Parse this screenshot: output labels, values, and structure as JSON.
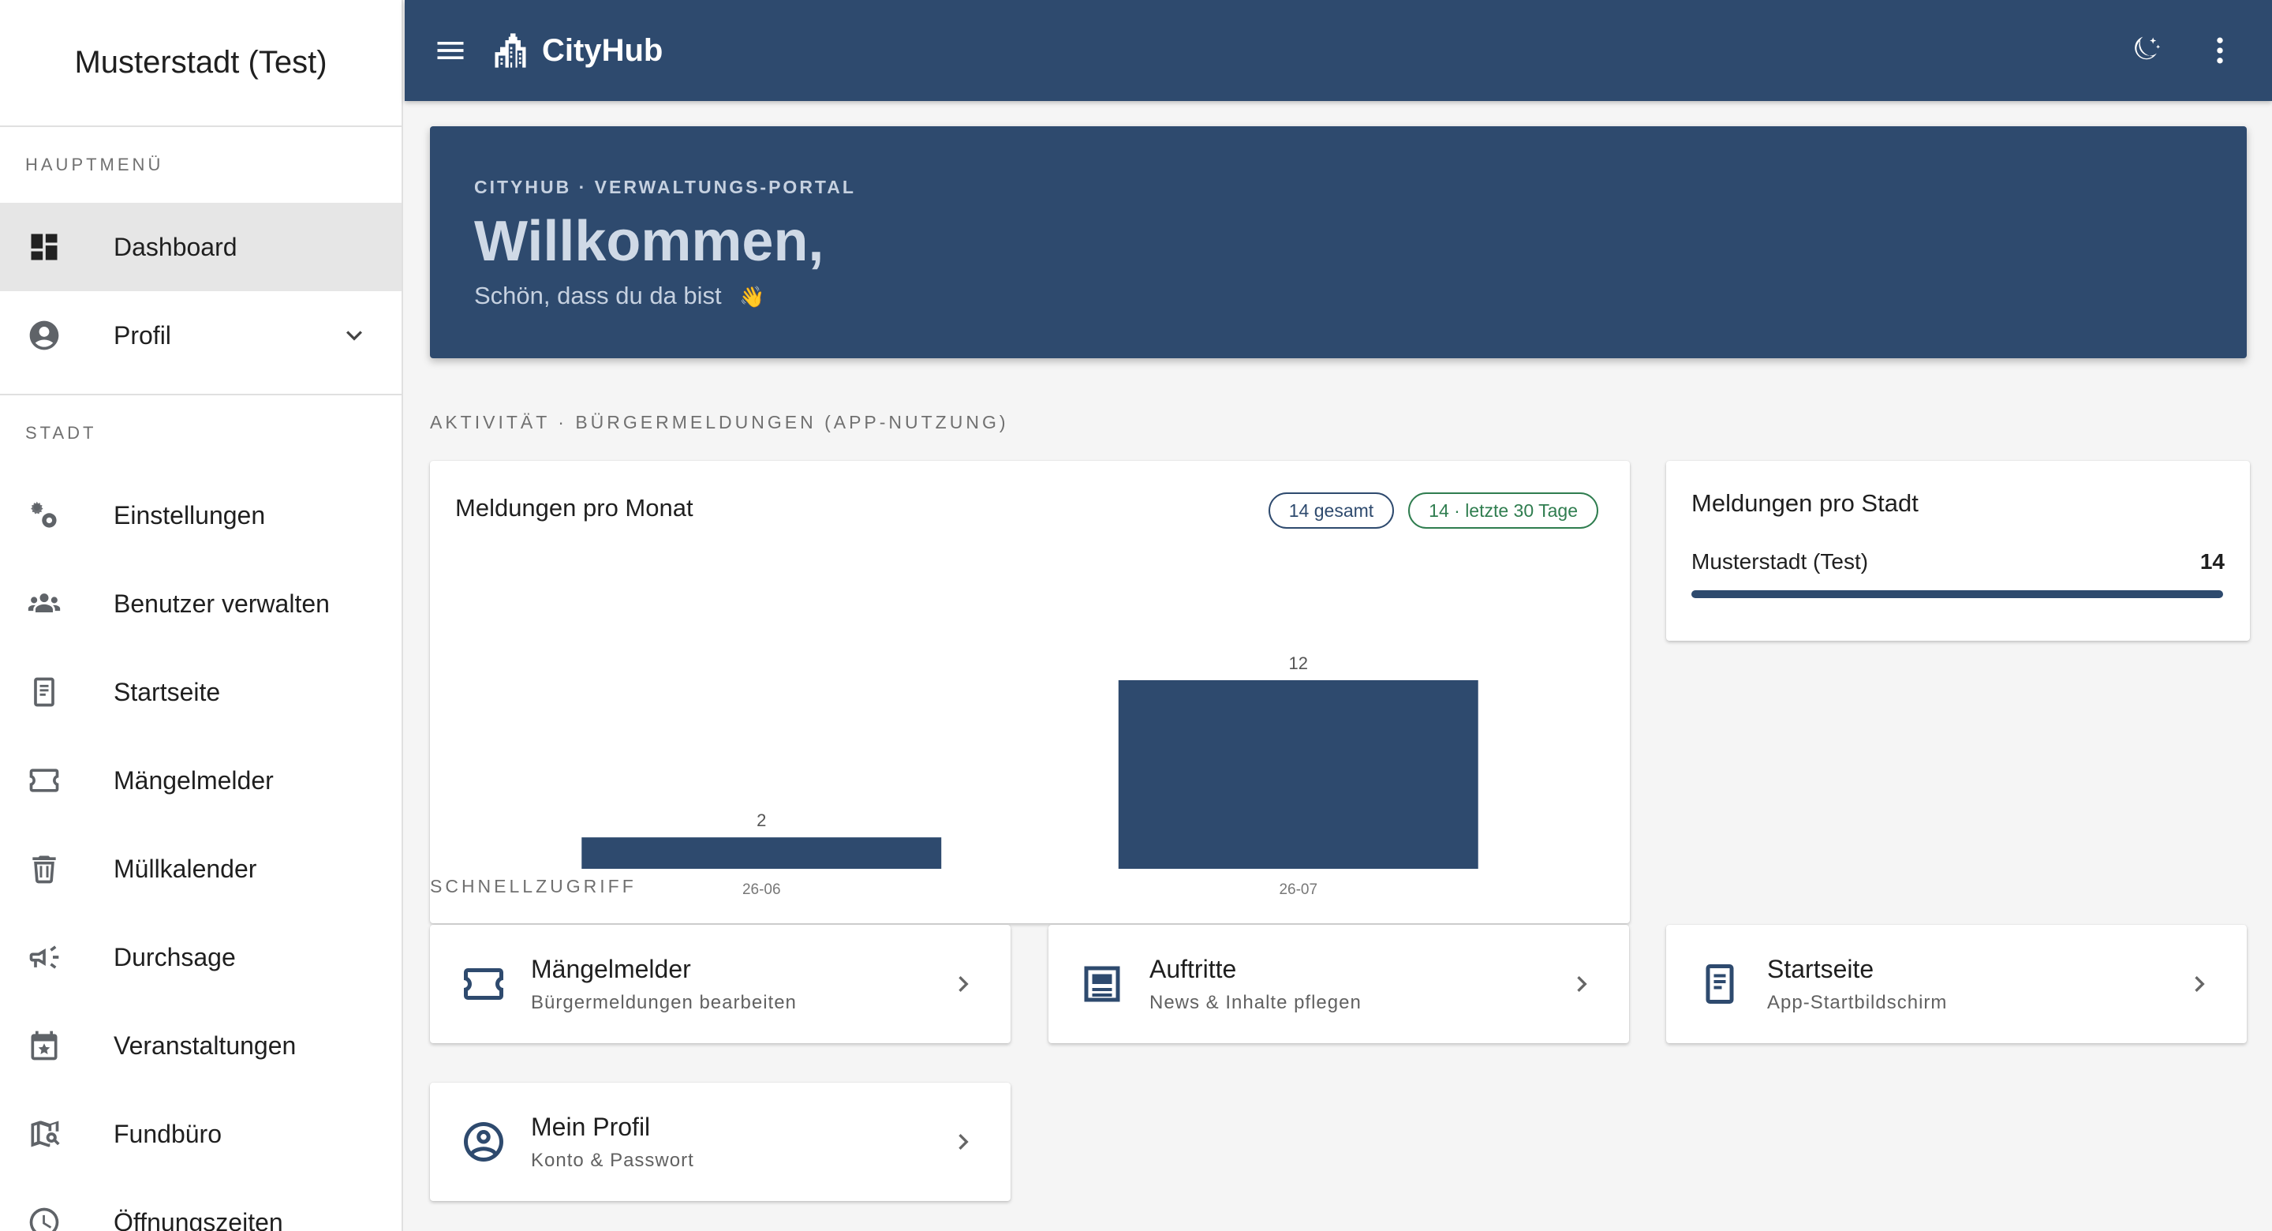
{
  "app": {
    "name": "CityHub"
  },
  "sidebar": {
    "title": "Musterstadt (Test)",
    "sections": [
      {
        "label": "HAUPTMENÜ"
      },
      {
        "label": "STADT"
      }
    ],
    "items": [
      {
        "label": "Dashboard",
        "icon": "dashboard-icon",
        "active": true
      },
      {
        "label": "Profil",
        "icon": "account-circle-icon"
      },
      {
        "label": "Einstellungen",
        "icon": "settings-icon"
      },
      {
        "label": "Benutzer verwalten",
        "icon": "people-icon"
      },
      {
        "label": "Startseite",
        "icon": "phone-page-icon"
      },
      {
        "label": "Mängelmelder",
        "icon": "ticket-icon"
      },
      {
        "label": "Müllkalender",
        "icon": "trash-icon"
      },
      {
        "label": "Durchsage",
        "icon": "megaphone-icon"
      },
      {
        "label": "Veranstaltungen",
        "icon": "calendar-star-icon"
      },
      {
        "label": "Fundbüro",
        "icon": "map-search-icon"
      },
      {
        "label": "Öffnungszeiten",
        "icon": "clock-icon"
      }
    ]
  },
  "hero": {
    "eyebrow": "CITYHUB · VERWALTUNGS-PORTAL",
    "title": "Willkommen,",
    "subtitle": "Schön, dass du da bist",
    "emoji": "👋"
  },
  "activity": {
    "label": "AKTIVITÄT · BÜRGERMELDUNGEN (APP-NUTZUNG)"
  },
  "monthly_card": {
    "title": "Meldungen pro Monat",
    "pill_total": "14 gesamt",
    "pill_recent": "14 · letzte 30 Tage"
  },
  "city_card": {
    "title": "Meldungen pro Stadt",
    "rows": [
      {
        "name": "Musterstadt (Test)",
        "count": "14",
        "share": 1.0
      }
    ]
  },
  "quick": {
    "label": "SCHNELLZUGRIFF",
    "items": [
      {
        "title": "Mängelmelder",
        "sub": "Bürgermeldungen bearbeiten",
        "icon": "ticket-icon"
      },
      {
        "title": "Auftritte",
        "sub": "News & Inhalte pflegen",
        "icon": "newspaper-icon"
      },
      {
        "title": "Startseite",
        "sub": "App-Startbildschirm",
        "icon": "phone-page-icon"
      },
      {
        "title": "Mein Profil",
        "sub": "Konto & Passwort",
        "icon": "account-circle-icon"
      }
    ]
  },
  "colors": {
    "primary": "#2e4a6e",
    "success": "#2f7d4f"
  },
  "chart_data": {
    "type": "bar",
    "categories": [
      "26-06",
      "26-07"
    ],
    "values": [
      2,
      12
    ],
    "title": "Meldungen pro Monat",
    "xlabel": "",
    "ylabel": "",
    "ylim": [
      0,
      12
    ],
    "grid": false
  }
}
